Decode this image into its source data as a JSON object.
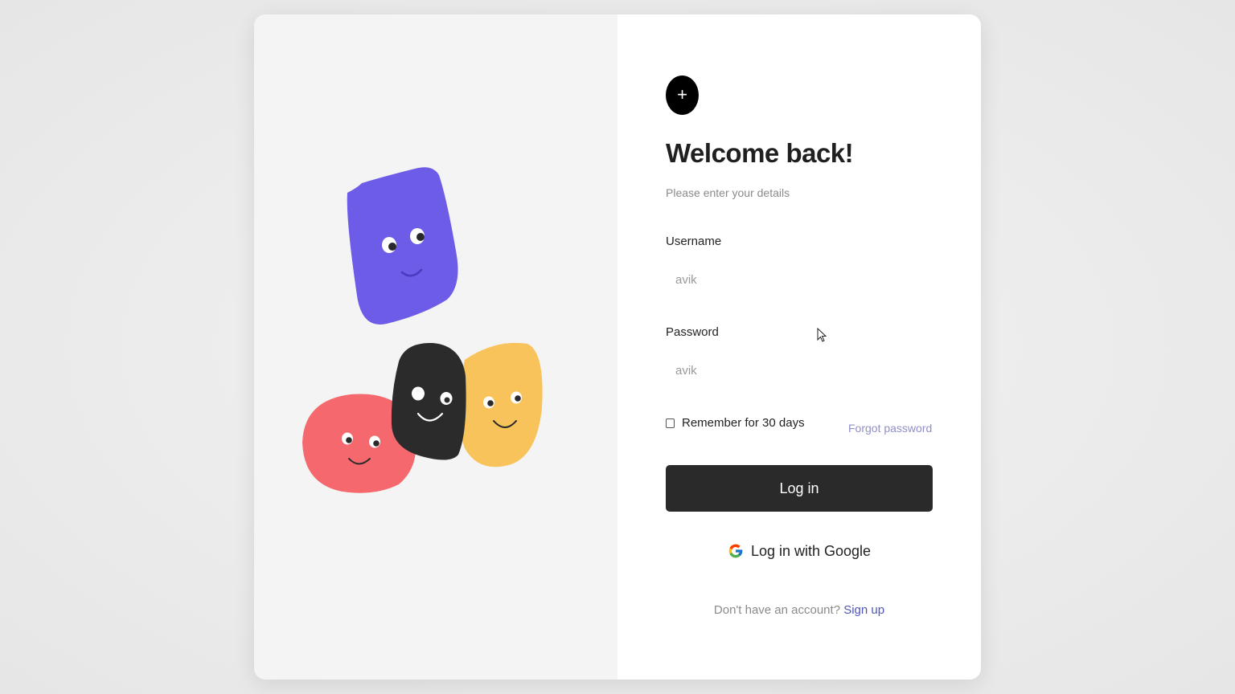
{
  "app": {
    "logo_glyph": "+",
    "title": "Welcome back!",
    "subtitle": "Please enter your details"
  },
  "form": {
    "username_label": "Username",
    "username_value": "avik",
    "password_label": "Password",
    "password_value": "avik",
    "remember_label": "Remember for 30 days",
    "remember_checked": false,
    "forgot_label": "Forgot password"
  },
  "actions": {
    "login_label": "Log in",
    "google_label": "Log in with Google"
  },
  "signup": {
    "prompt": "Don't have an account?",
    "link_label": "Sign up"
  },
  "colors": {
    "primary_button": "#2a2a2a",
    "link": "#4d55b8",
    "forgot_link": "#8f8fc8",
    "purple_character": "#6c5ce7",
    "black_character": "#2b2b2b",
    "yellow_character": "#f7c35a",
    "red_character": "#f5696e"
  },
  "icons": {
    "logo": "plus-icon",
    "google": "google-g-icon",
    "cursor": "mouse-cursor-icon"
  }
}
